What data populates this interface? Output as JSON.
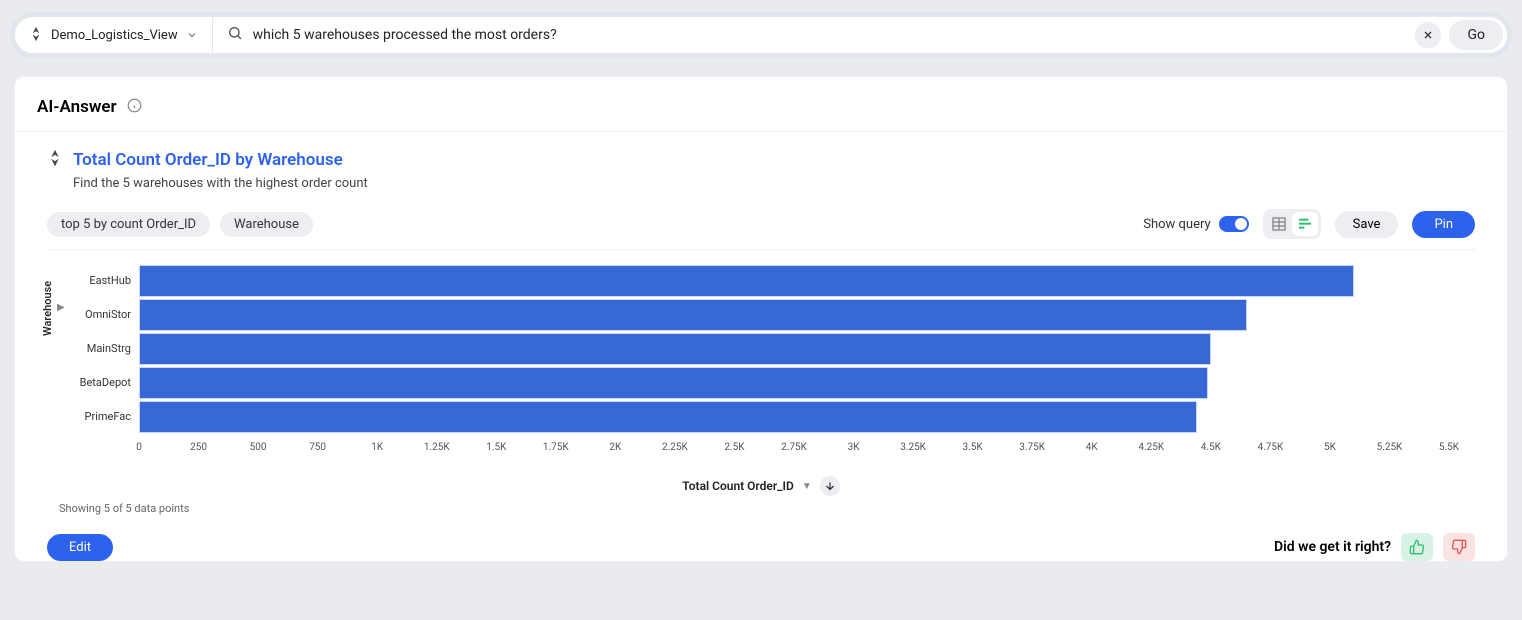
{
  "search": {
    "source_name": "Demo_Logistics_View",
    "query": "which 5 warehouses processed the most orders?",
    "go_label": "Go"
  },
  "header": {
    "title": "AI-Answer"
  },
  "answer": {
    "title": "Total Count Order_ID by Warehouse",
    "subtitle": "Find the 5 warehouses with the highest order count",
    "chips": [
      "top 5 by count Order_ID",
      "Warehouse"
    ]
  },
  "controls": {
    "show_query": "Show query",
    "save": "Save",
    "pin": "Pin"
  },
  "chart_data": {
    "type": "bar",
    "orientation": "horizontal",
    "categories": [
      "EastHub",
      "OmniStor",
      "MainStrg",
      "BetaDepot",
      "PrimeFac"
    ],
    "values": [
      5100,
      4650,
      4500,
      4490,
      4440
    ],
    "xlabel": "Total Count Order_ID",
    "ylabel": "Warehouse",
    "xlim": [
      0,
      5500
    ],
    "x_ticks": [
      0,
      250,
      500,
      750,
      1000,
      1250,
      1500,
      1750,
      2000,
      2250,
      2500,
      2750,
      3000,
      3250,
      3500,
      3750,
      4000,
      4250,
      4500,
      4750,
      5000,
      5250,
      5500
    ],
    "x_tick_labels": [
      "0",
      "250",
      "500",
      "750",
      "1K",
      "1.25K",
      "1.5K",
      "1.75K",
      "2K",
      "2.25K",
      "2.5K",
      "2.75K",
      "3K",
      "3.25K",
      "3.5K",
      "3.75K",
      "4K",
      "4.25K",
      "4.5K",
      "4.75K",
      "5K",
      "5.25K",
      "5.5K"
    ]
  },
  "note": "Showing 5 of 5 data points",
  "footer": {
    "edit": "Edit",
    "feedback_prompt": "Did we get it right?"
  }
}
